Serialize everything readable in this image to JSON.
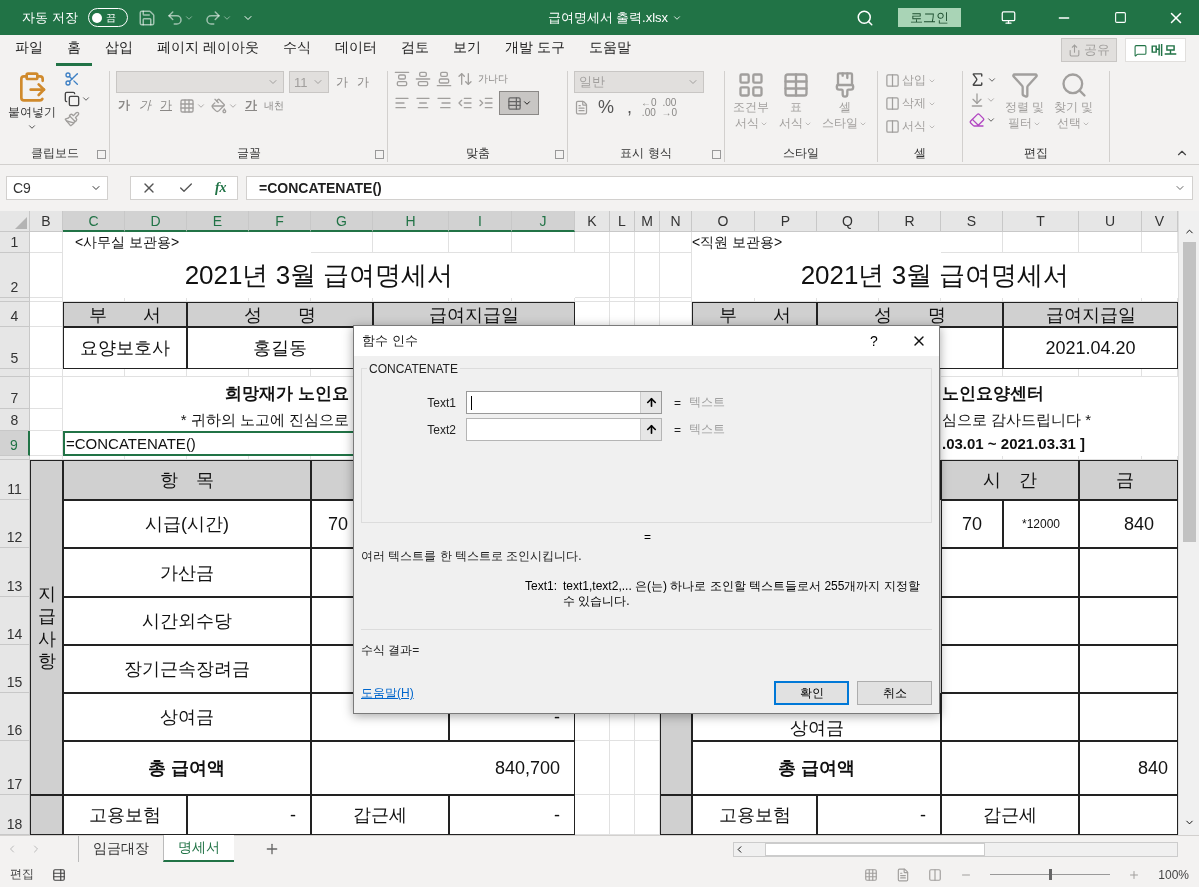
{
  "title_bar": {
    "autosave_label": "자동 저장",
    "autosave_state": "끔",
    "autosave_on": false,
    "file_name": "급여명세서 출력.xlsx",
    "login": "로그인"
  },
  "menu_tabs": [
    {
      "label": "파일",
      "selected": false
    },
    {
      "label": "홈",
      "selected": true
    },
    {
      "label": "삽입",
      "selected": false
    },
    {
      "label": "페이지 레이아웃",
      "selected": false
    },
    {
      "label": "수식",
      "selected": false
    },
    {
      "label": "데이터",
      "selected": false
    },
    {
      "label": "검토",
      "selected": false
    },
    {
      "label": "보기",
      "selected": false
    },
    {
      "label": "개발 도구",
      "selected": false
    },
    {
      "label": "도움말",
      "selected": false
    }
  ],
  "share": "공유",
  "memo": "메모",
  "ribbon": {
    "paste": "붙여넣기",
    "font_size": "11",
    "grow_font": "가",
    "shrink_font": "가",
    "bold": "가",
    "italic": "가",
    "underline": "가",
    "font_color": "가",
    "phonetic": "내천",
    "wrap": "가나다",
    "number_format": "일반",
    "percent": "%",
    "comma": ",",
    "inc_decimal": [
      "←0",
      ".00"
    ],
    "dec_decimal": [
      ".00",
      "→0"
    ],
    "style_buttons": [
      {
        "lines": [
          "조건부",
          "서식"
        ]
      },
      {
        "lines": [
          "표",
          "서식"
        ]
      },
      {
        "lines": [
          "셀",
          "스타일"
        ]
      }
    ],
    "cell_buttons": [
      "삽입",
      "삭제",
      "서식"
    ],
    "edit_buttons": [
      {
        "lines": [
          "정렬 및",
          "필터"
        ]
      },
      {
        "lines": [
          "찾기 및",
          "선택"
        ]
      }
    ],
    "groups": [
      "클립보드",
      "글꼴",
      "맞춤",
      "표시 형식",
      "스타일",
      "셀",
      "편집"
    ]
  },
  "formula_bar": {
    "name_box": "C9",
    "fx": "fx",
    "formula": "=CONCATENATE()"
  },
  "columns": [
    {
      "label": "B",
      "selected": false
    },
    {
      "label": "C",
      "selected": true
    },
    {
      "label": "D",
      "selected": true
    },
    {
      "label": "E",
      "selected": true
    },
    {
      "label": "F",
      "selected": true
    },
    {
      "label": "G",
      "selected": true
    },
    {
      "label": "H",
      "selected": true
    },
    {
      "label": "I",
      "selected": true
    },
    {
      "label": "J",
      "selected": true
    },
    {
      "label": "K",
      "selected": false
    },
    {
      "label": "L",
      "selected": false
    },
    {
      "label": "M",
      "selected": false
    },
    {
      "label": "N",
      "selected": false
    },
    {
      "label": "O",
      "selected": false
    },
    {
      "label": "P",
      "selected": false
    },
    {
      "label": "Q",
      "selected": false
    },
    {
      "label": "R",
      "selected": false
    },
    {
      "label": "S",
      "selected": false
    },
    {
      "label": "T",
      "selected": false
    },
    {
      "label": "U",
      "selected": false
    },
    {
      "label": "V",
      "selected": false
    }
  ],
  "rows": [
    {
      "label": "1",
      "selected": false
    },
    {
      "label": "2",
      "selected": false
    },
    {
      "label": "4",
      "selected": false
    },
    {
      "label": "5",
      "selected": false
    },
    {
      "label": "7",
      "selected": false
    },
    {
      "label": "8",
      "selected": false
    },
    {
      "label": "9",
      "selected": true
    },
    {
      "label": "11",
      "selected": false
    },
    {
      "label": "12",
      "selected": false
    },
    {
      "label": "13",
      "selected": false
    },
    {
      "label": "14",
      "selected": false
    },
    {
      "label": "15",
      "selected": false
    },
    {
      "label": "16",
      "selected": false
    },
    {
      "label": "17",
      "selected": false
    },
    {
      "label": "18",
      "selected": false
    }
  ],
  "cells": [
    {
      "text": "<사무실 보관용>",
      "kind": "note"
    },
    {
      "text": "2021년 3월 급여명세서",
      "kind": "title"
    },
    {
      "text": "부　　서",
      "kind": "head"
    },
    {
      "text": "성　　명",
      "kind": "head"
    },
    {
      "text": "급여지급일",
      "kind": "head"
    },
    {
      "text": "요양보호사",
      "kind": "value"
    },
    {
      "text": "홍길동",
      "kind": "value"
    },
    {
      "text": "희망재가 노인요",
      "kind": "bold"
    },
    {
      "text": "* 귀하의 노고에 진심으로",
      "kind": "text"
    },
    {
      "text": "지급사항",
      "kind": "vertical"
    },
    {
      "text": "항　목",
      "kind": "head"
    },
    {
      "text": "시급(시간)",
      "kind": "item"
    },
    {
      "text": "70",
      "kind": "item"
    },
    {
      "text": "가산금",
      "kind": "item"
    },
    {
      "text": "시간외수당",
      "kind": "item"
    },
    {
      "text": "장기근속장려금",
      "kind": "item"
    },
    {
      "text": "상여금",
      "kind": "item"
    },
    {
      "text": "-",
      "kind": "amount"
    },
    {
      "text": "총 급여액",
      "kind": "total"
    },
    {
      "text": "840,700",
      "kind": "amount"
    },
    {
      "text": "고용보험",
      "kind": "item"
    },
    {
      "text": "-",
      "kind": "amount"
    },
    {
      "text": "갑근세",
      "kind": "item"
    },
    {
      "text": "-",
      "kind": "amount"
    },
    {
      "text": "<직원 보관용>",
      "kind": "note"
    },
    {
      "text": "2021년 3월 급여명세서",
      "kind": "title"
    },
    {
      "text": "부　　서",
      "kind": "head"
    },
    {
      "text": "성　　명",
      "kind": "head"
    },
    {
      "text": "급여지급일",
      "kind": "head"
    },
    {
      "text": "2021.04.20",
      "kind": "value"
    },
    {
      "text": "노인요양센터",
      "kind": "bold"
    },
    {
      "text": "심으로 감사드립니다 *",
      "kind": "text"
    },
    {
      "text": ".03.01 ~ 2021.03.31 ]",
      "kind": "period"
    },
    {
      "text": "시　간",
      "kind": "head"
    },
    {
      "text": "금",
      "kind": "head"
    },
    {
      "text": "70",
      "kind": "item"
    },
    {
      "text": "*12000",
      "kind": "small"
    },
    {
      "text": "840",
      "kind": "amount"
    },
    {
      "text": "상여금",
      "kind": "item"
    },
    {
      "text": "총 급여액",
      "kind": "total"
    },
    {
      "text": "840",
      "kind": "amount"
    },
    {
      "text": "고용보험",
      "kind": "item"
    },
    {
      "text": "-",
      "kind": "amount"
    },
    {
      "text": "갑근세",
      "kind": "item"
    }
  ],
  "active_cell": "=CONCATENATE()",
  "sheet_tabs": [
    {
      "label": "임금대장",
      "selected": false
    },
    {
      "label": "명세서",
      "selected": true
    }
  ],
  "status": {
    "mode": "편집",
    "zoom": "100%",
    "zoom_slider": {
      "level": 0.5
    }
  },
  "dialog": {
    "title": "함수 인수",
    "help": "?",
    "function_name": "CONCATENATE",
    "args": [
      {
        "label": "Text1",
        "eq": "=",
        "result": "텍스트",
        "focused": true
      },
      {
        "label": "Text2",
        "eq": "=",
        "result": "텍스트",
        "focused": false
      }
    ],
    "result_eq": "=",
    "description": "여러 텍스트를 한 텍스트로 조인시킵니다.",
    "arg_help_label": "Text1:",
    "arg_help": "text1,text2,... 은(는) 하나로 조인할 텍스트들로서 255개까지 지정할 수 있습니다.",
    "formula_result": "수식 결과=",
    "help_link": "도움말(H)",
    "ok": "확인",
    "cancel": "취소"
  }
}
